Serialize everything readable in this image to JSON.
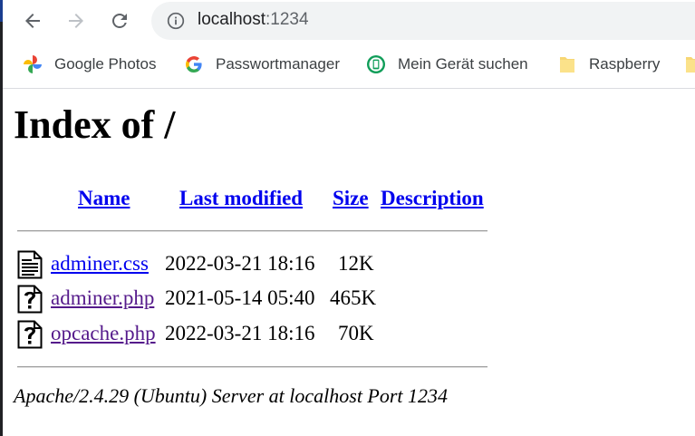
{
  "browser": {
    "url_host": "localhost",
    "url_port": ":1234",
    "nav": {
      "back": "back-icon",
      "forward": "forward-icon",
      "reload": "reload-icon",
      "info": "info-icon"
    }
  },
  "bookmarks": [
    {
      "label": "Google Photos",
      "icon": "google-photos-icon"
    },
    {
      "label": "Passwortmanager",
      "icon": "google-icon"
    },
    {
      "label": "Mein Gerät suchen",
      "icon": "find-device-icon"
    },
    {
      "label": "Raspberry",
      "icon": "folder-icon"
    }
  ],
  "page": {
    "title": "Index of /",
    "columns": {
      "name": "Name",
      "modified": "Last modified",
      "size": "Size",
      "description": "Description"
    },
    "files": [
      {
        "name": "adminer.css",
        "modified": "2022-03-21 18:16",
        "size": "12K",
        "icon": "text-file-icon",
        "visited": false
      },
      {
        "name": "adminer.php",
        "modified": "2021-05-14 05:40",
        "size": "465K",
        "icon": "unknown-file-icon",
        "visited": true
      },
      {
        "name": "opcache.php",
        "modified": "2022-03-21 18:16",
        "size": "70K",
        "icon": "unknown-file-icon",
        "visited": true
      }
    ],
    "footer": "Apache/2.4.29 (Ubuntu) Server at localhost Port 1234"
  },
  "colors": {
    "link": "#0000ee",
    "visited": "#551a8b",
    "omnibox": "#f1f3f4"
  }
}
